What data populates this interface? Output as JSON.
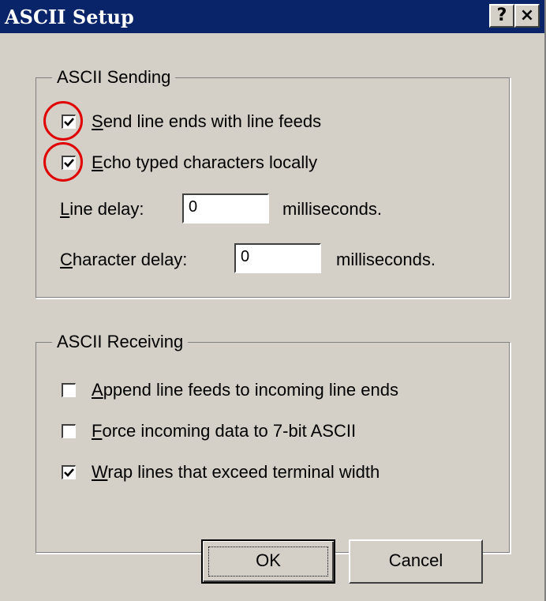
{
  "window": {
    "title": "ASCII Setup",
    "help_label": "?",
    "close_label": "×"
  },
  "sending": {
    "legend": "ASCII Sending",
    "send_line_ends": {
      "hotkey": "S",
      "rest": "end line ends with line feeds",
      "checked": true
    },
    "echo_typed": {
      "hotkey": "E",
      "rest": "cho typed characters locally",
      "checked": true
    },
    "line_delay": {
      "hotkey": "L",
      "rest": "ine delay:",
      "value": "0",
      "units": "milliseconds."
    },
    "char_delay": {
      "hotkey": "C",
      "rest": "haracter delay:",
      "value": "0",
      "units": "milliseconds."
    }
  },
  "receiving": {
    "legend": "ASCII Receiving",
    "append_line_feeds": {
      "hotkey": "A",
      "rest": "ppend line feeds to incoming line ends",
      "checked": false
    },
    "force_7bit": {
      "hotkey": "F",
      "rest": "orce incoming data to 7-bit ASCII",
      "checked": false
    },
    "wrap_lines": {
      "hotkey": "W",
      "rest": "rap lines that exceed terminal width",
      "checked": true
    }
  },
  "buttons": {
    "ok": "OK",
    "cancel": "Cancel"
  },
  "colors": {
    "titlebar": "#0a246a",
    "face": "#d4d0c8",
    "annotation": "#e00000"
  }
}
